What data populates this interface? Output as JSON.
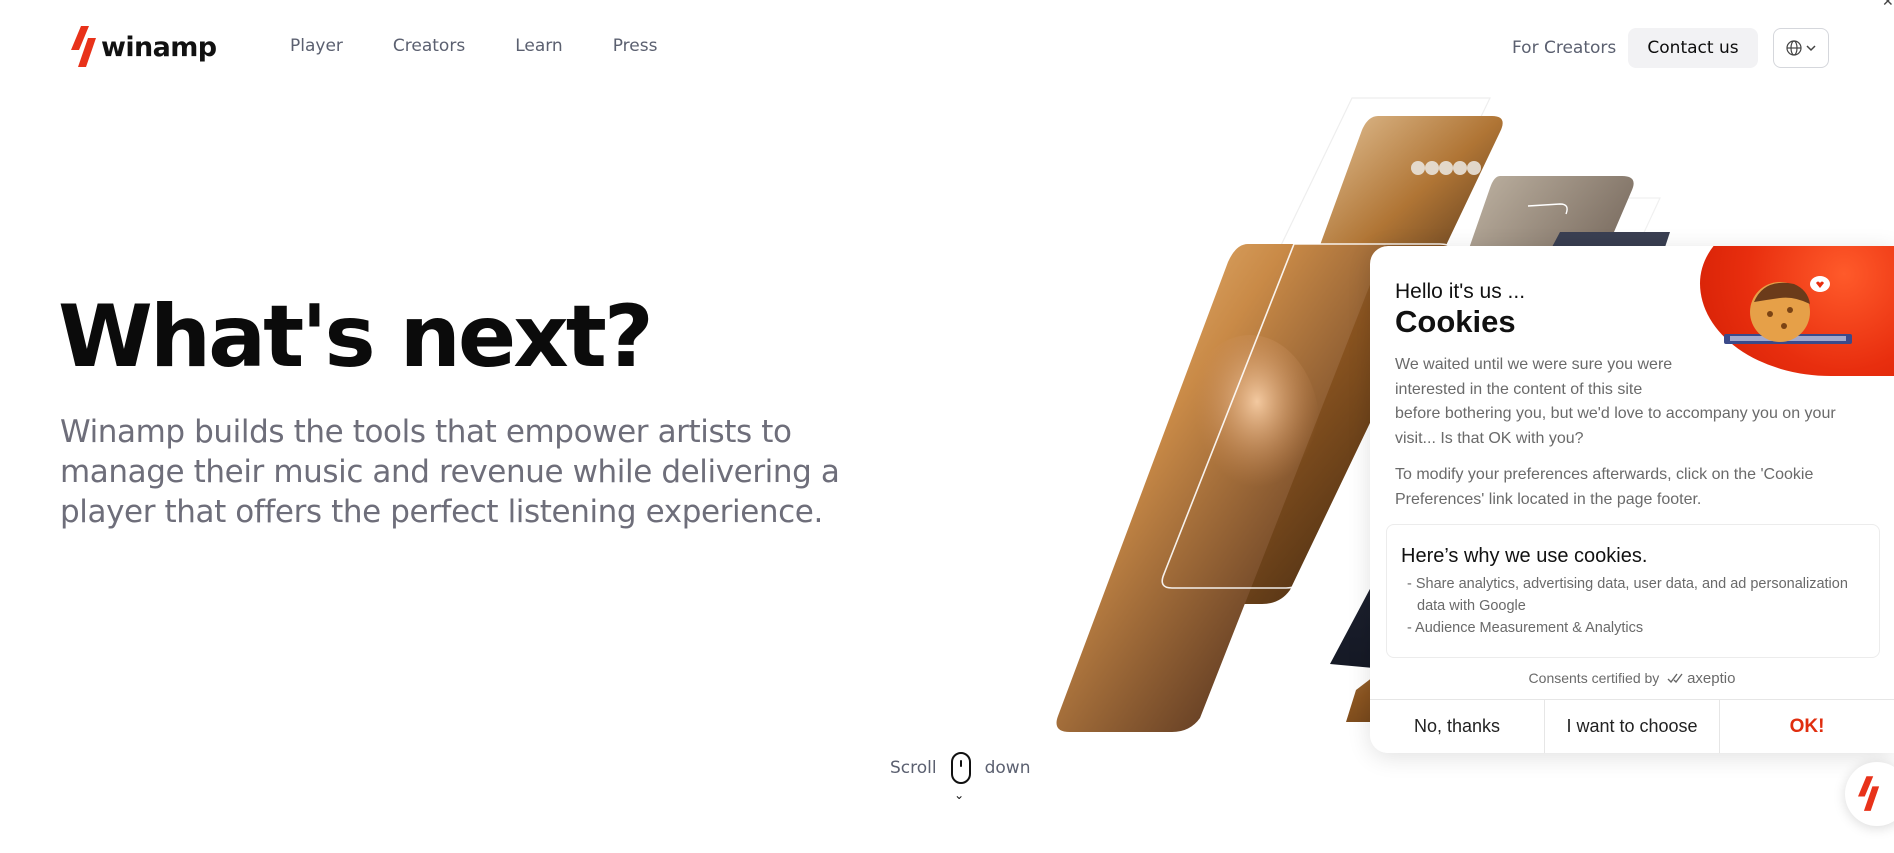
{
  "header": {
    "logo_text": "winamp",
    "nav": [
      "Player",
      "Creators",
      "Learn",
      "Press"
    ],
    "for_creators": "For Creators",
    "contact": "Contact us"
  },
  "hero": {
    "title": "What's next?",
    "subtitle_lines": [
      "Winamp builds the tools that empower artists to",
      "manage their music and revenue while delivering a",
      "player that offers the perfect listening experience."
    ]
  },
  "scroll": {
    "left": "Scroll",
    "right": "down"
  },
  "cookie": {
    "hello": "Hello it's us ...",
    "title": "Cookies",
    "intro_lines": [
      "We waited until we were sure you were",
      "interested in the content of this site",
      "before bothering you, but we'd love to accompany you on your",
      "visit... Is that OK with you?"
    ],
    "preferences": "To modify your preferences afterwards, click on the 'Cookie Preferences' link located in the page footer.",
    "why_title": "Here’s why we use cookies.",
    "why_items": [
      "- Share analytics, advertising data, user data, and ad personalization data with Google",
      "- Audience Measurement & Analytics"
    ],
    "certified": "Consents certified by",
    "certified_brand": "axeptio",
    "buttons": [
      "No, thanks",
      "I want to choose",
      "OK!"
    ]
  },
  "colors": {
    "brand": "#e8321a",
    "accent_ok": "#e02e0f",
    "text_muted": "#6e6e7a"
  }
}
